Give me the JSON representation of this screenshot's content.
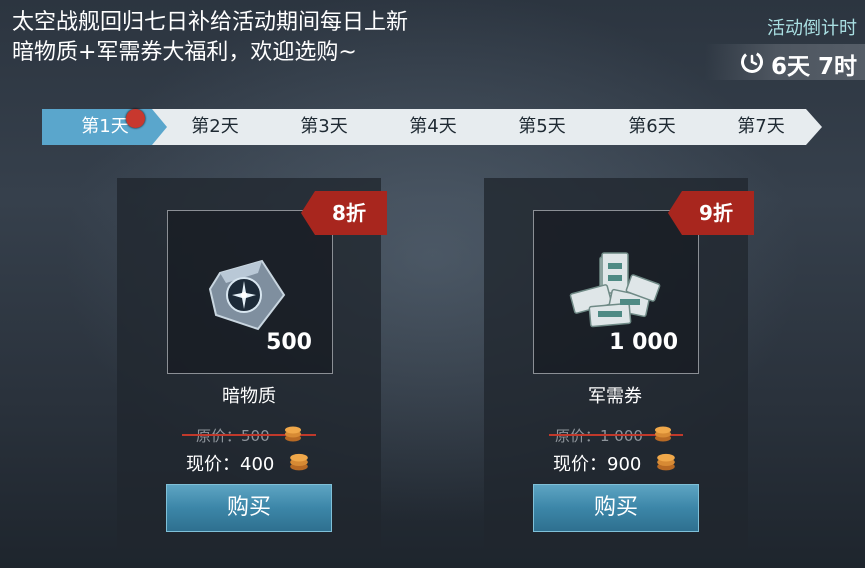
{
  "header": {
    "line1": "太空战舰回归七日补给活动期间每日上新",
    "line2": "暗物质+军需券大福利，欢迎选购~"
  },
  "countdown": {
    "label": "活动倒计时",
    "value": "6天 7时",
    "icon": "clock-icon"
  },
  "tabs": [
    {
      "label": "第1天",
      "active": true,
      "has_notification": true
    },
    {
      "label": "第2天",
      "active": false
    },
    {
      "label": "第3天",
      "active": false
    },
    {
      "label": "第4天",
      "active": false
    },
    {
      "label": "第5天",
      "active": false
    },
    {
      "label": "第6天",
      "active": false
    },
    {
      "label": "第7天",
      "active": false
    }
  ],
  "items": [
    {
      "discount": "8折",
      "quantity": "500",
      "name": "暗物质",
      "original_price": "原价：500",
      "current_price": "现价：400",
      "buy_label": "购买",
      "icon": "dark-matter-icon"
    },
    {
      "discount": "9折",
      "quantity": "1 000",
      "name": "军需券",
      "original_price": "原价：1 000",
      "current_price": "现价：900",
      "buy_label": "购买",
      "icon": "voucher-stack-icon"
    }
  ],
  "colors": {
    "active_tab": "#5aa6cc",
    "inactive_tab": "#e7ecef",
    "discount_ribbon": "#a8261e",
    "buy_button": "#3c86a8",
    "countdown_label": "#a9dfe2",
    "strike": "#c0392b"
  }
}
